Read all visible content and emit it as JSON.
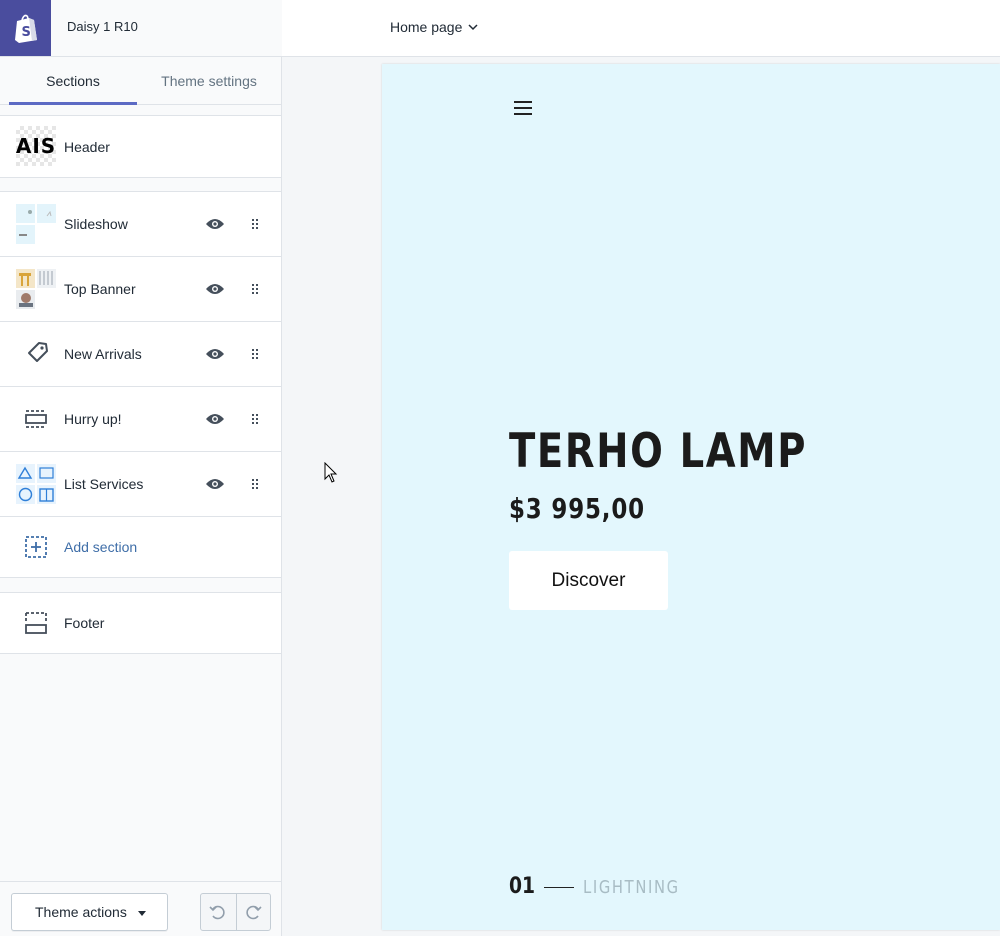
{
  "store": {
    "name": "Daisy 1 R10"
  },
  "tabs": {
    "sections": "Sections",
    "theme_settings": "Theme settings"
  },
  "sections": {
    "header": {
      "label": "Header",
      "thumb_text": "AIS"
    },
    "items": [
      {
        "label": "Slideshow"
      },
      {
        "label": "Top Banner"
      },
      {
        "label": "New Arrivals"
      },
      {
        "label": "Hurry up!"
      },
      {
        "label": "List Services"
      }
    ],
    "add_label": "Add section",
    "footer": {
      "label": "Footer"
    }
  },
  "bottom": {
    "theme_actions": "Theme actions"
  },
  "preview_bar": {
    "page": "Home page"
  },
  "preview": {
    "title": "TERHO LAMP",
    "price": "$3 995,00",
    "button": "Discover",
    "slide_number": "01",
    "slide_name": "LIGHTNING"
  },
  "colors": {
    "accent": "#5c6ac4",
    "logo_bg": "#4a4d9e",
    "preview_bg": "#e3f7fd",
    "link": "#3f6ea8"
  }
}
